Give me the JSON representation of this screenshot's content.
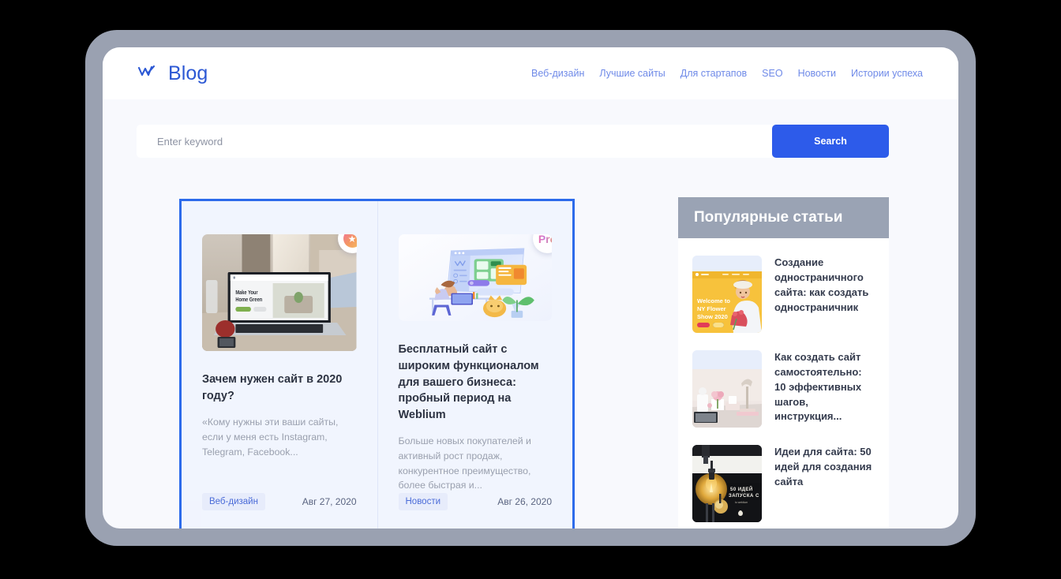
{
  "header": {
    "brand": "Blog",
    "logo_icon": "weblium-crown-icon",
    "brand_color": "#2c58d4",
    "nav": [
      {
        "label": "Веб-дизайн"
      },
      {
        "label": "Лучшие сайты"
      },
      {
        "label": "Для стартапов"
      },
      {
        "label": "SEO"
      },
      {
        "label": "Новости"
      },
      {
        "label": "Истории успеха"
      }
    ]
  },
  "search": {
    "placeholder": "Enter keyword",
    "value": "",
    "button_label": "Search",
    "button_color": "#2d5bea"
  },
  "posts": [
    {
      "badge_type": "star",
      "badge_label": "",
      "image_alt": "laptop-on-desk-photo",
      "image_screen_text": "Make Your Home Green",
      "title": "Зачем нужен сайт в 2020 году?",
      "excerpt": "«Кому нужны эти ваши сайты, если у меня есть Instagram, Telegram, Facebook...",
      "tag": "Веб-дизайн",
      "date": "Авг 27, 2020"
    },
    {
      "badge_type": "pro",
      "badge_label": "Pro",
      "image_alt": "person-at-desk-illustration",
      "image_screen_text": "",
      "title": "Бесплатный сайт с широким функционалом для вашего бизнеса: пробный период на Weblium",
      "excerpt": "Больше новых покупателей и активный рост продаж, конкурентное преимущество, более быстрая и...",
      "tag": "Новости",
      "date": "Авг 26, 2020"
    }
  ],
  "sidebar": {
    "title": "Популярные статьи",
    "header_color": "#9aa3b4",
    "items": [
      {
        "thumb_alt": "ny-flower-show-yellow-template",
        "thumb_text": "Welcome to NY Flower Show 2020",
        "title": "Создание одностраничного сайта: как создать одностраничник"
      },
      {
        "thumb_alt": "white-desk-with-lamp-photo",
        "thumb_text": "",
        "title": "Как создать сайт самостоятельно: 10 эффективных шагов, инструкция..."
      },
      {
        "thumb_alt": "light-bulb-dark-poster",
        "thumb_text": "50 ИДЕЙ ЗАПУСКА С",
        "title": "Идеи для сайта: 50 идей для создания сайта"
      }
    ]
  }
}
